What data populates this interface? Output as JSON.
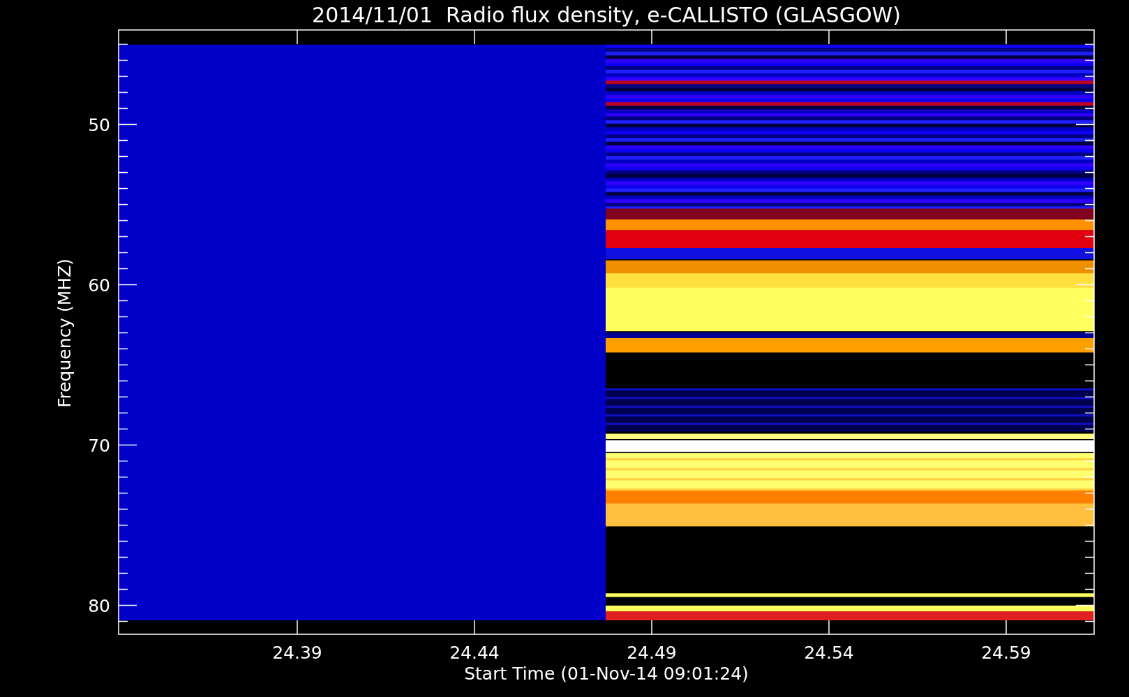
{
  "plot": {
    "title": "2014/11/01  Radio flux density, e-CALLISTO (GLASGOW)",
    "ylabel": "Frequency (MHZ)",
    "xlabel": "Start Time (01-Nov-14 09:01:24)",
    "yticks": [
      "50",
      "60",
      "70",
      "80"
    ],
    "xticks": [
      "24.39",
      "24.44",
      "24.49",
      "24.54",
      "24.59"
    ]
  }
}
